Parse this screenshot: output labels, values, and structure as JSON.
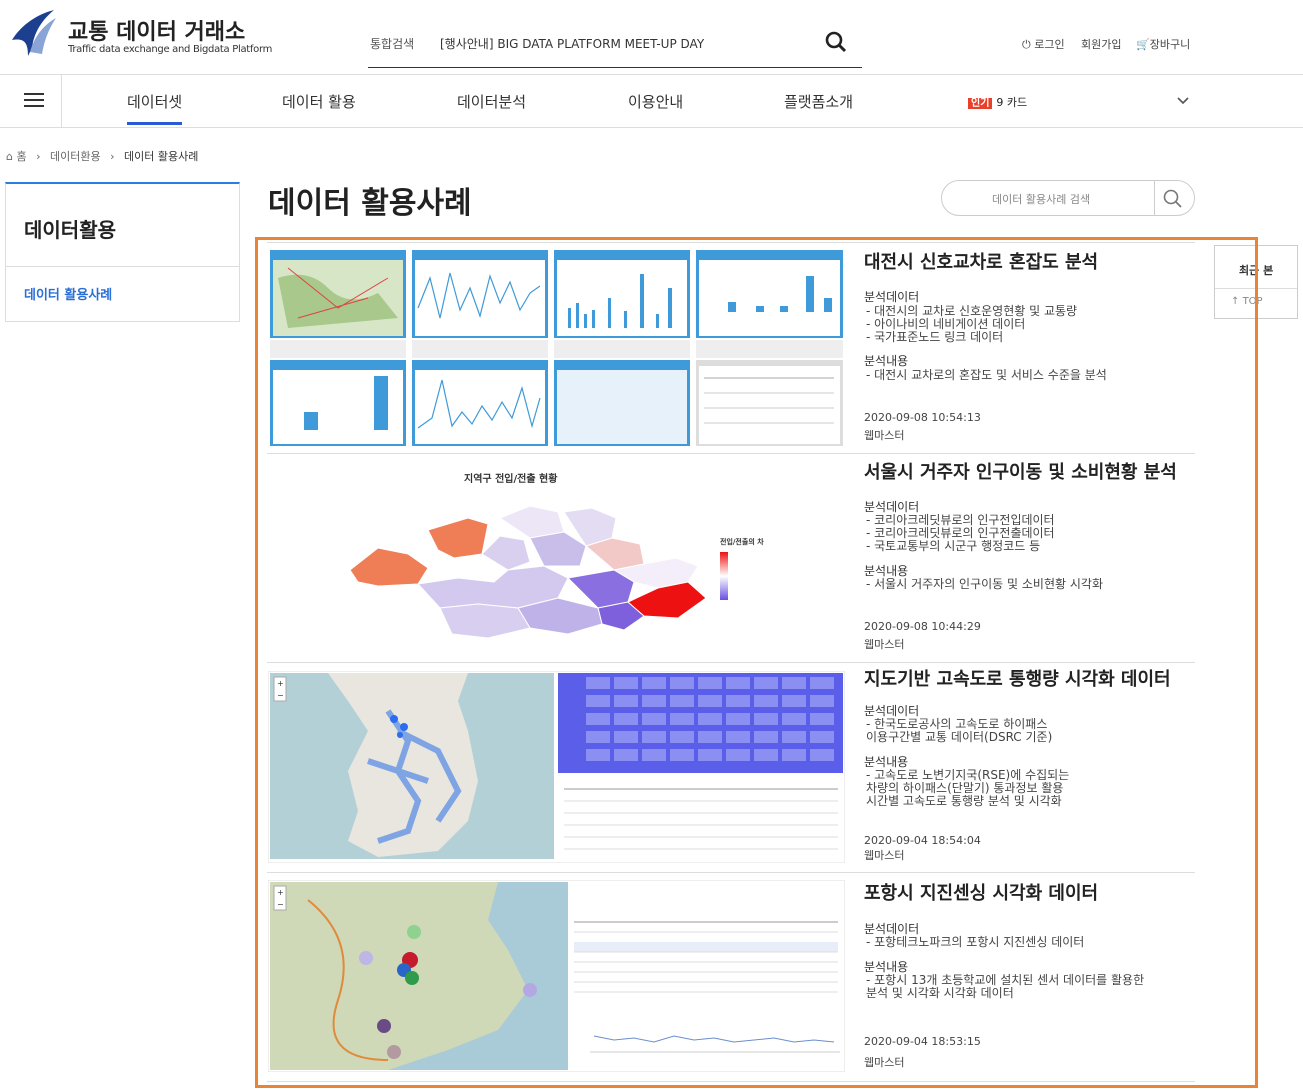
{
  "header": {
    "logo_title": "교통 데이터 거래소",
    "logo_sub": "Traffic data exchange and Bigdata Platform",
    "search_label": "통합검색",
    "search_value": "[행사안내] BIG DATA PLATFORM MEET-UP DAY",
    "util": {
      "login": "로그인",
      "join": "회원가입",
      "cart": "장바구니"
    }
  },
  "gnb": {
    "items": [
      "데이터셋",
      "데이터 활용",
      "데이터분석",
      "이용안내",
      "플랫폼소개"
    ],
    "active_index": 0,
    "hot_badge": "인기",
    "hot_text": "9 카드"
  },
  "breadcrumb": {
    "home": "홈",
    "level1": "데이터환용",
    "level2": "데이터 활용사례"
  },
  "lnb": {
    "title": "데이터활용",
    "item": "데이터 활용사례"
  },
  "page": {
    "title": "데이터 활용사례",
    "search_placeholder": "데이터 활용사례 검색"
  },
  "side": {
    "recent": "최근 본",
    "top": "TOP"
  },
  "items": [
    {
      "title": "대전시 신호교차로 혼잡도 분석",
      "data_label": "분석데이터",
      "data_lines": [
        "- 대전시의 교차로 신호운영현황 및 교통량",
        "- 아이나비의 네비게이션 데이터",
        "- 국가표준노드 링크 데이터"
      ],
      "content_label": "분석내용",
      "content_lines": [
        "- 대전시 교차로의 혼잡도 및 서비스 수준을 분석"
      ],
      "date": "2020-09-08 10:54:13",
      "author": "웹마스터"
    },
    {
      "title": "서울시 거주자 인구이동 및 소비현황 분석",
      "data_label": "분석데이터",
      "data_lines": [
        "- 코리아크레딧뷰로의 인구전입데이터",
        "- 코리아크레딧뷰로의 인구전출데이터",
        "- 국토교통부의 시군구 행정코드 등"
      ],
      "content_label": "분석내용",
      "content_lines": [
        "- 서울시 거주자의 인구이동 및 소비현황 시각화"
      ],
      "date": "2020-09-08 10:44:29",
      "author": "웹마스터",
      "thumb_title": "지역구 전입/전출 현황",
      "thumb_legend": "전입/전출의 차"
    },
    {
      "title": "지도기반 고속도로 통행량 시각화 데이터",
      "data_label": "분석데이터",
      "data_lines": [
        "- 한국도로공사의 고속도로 하이패스",
        "  이용구간별 교통 데이터(DSRC 기준)"
      ],
      "content_label": "분석내용",
      "content_lines": [
        "- 고속도로 노변기지국(RSE)에 수집되는",
        "  차량의 하이패스(단말기) 통과정보 활용",
        "  시간별 고속도로 통행량 분석 및 시각화"
      ],
      "date": "2020-09-04 18:54:04",
      "author": "웹마스터"
    },
    {
      "title": "포항시 지진센싱 시각화 데이터",
      "data_label": "분석데이터",
      "data_lines": [
        "- 포항테크노파크의 포항시 지진센싱 데이터"
      ],
      "content_label": "분석내용",
      "content_lines": [
        "- 포항시 13개 초등학교에 설치된 센서 데이터를 활용한",
        "  분석 및 시각화 시각화 데이터"
      ],
      "date": "2020-09-04 18:53:15",
      "author": "웹마스터"
    }
  ],
  "colors": {
    "accent": "#2a5bd7",
    "highlight": "#e98437",
    "hot": "#e8412b"
  }
}
